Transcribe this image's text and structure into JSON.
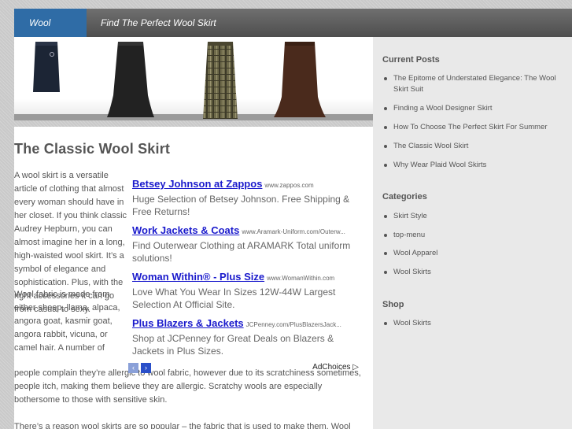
{
  "nav": {
    "home": "Wool Skirt",
    "find": "Find The Perfect Wool Skirt"
  },
  "main": {
    "title": "The Classic Wool Skirt",
    "p1": "A wool skirt is a versatile article of clothing that almost every woman should have in her closet. If you think classic Audrey Hepburn, you can almost imagine her in a long, high-waisted wool skirt.  It’s a symbol of elegance and sophistication. Plus, with the right accessories it can go from casual to sexy.",
    "p2": "Wool fabric is made from either sheep, llama, alpaca, angora goat, kasmir goat, angora rabbit, vicuna, or camel hair.  A number of",
    "p2_rest": "people complain they’re allergic to wool fabric, however due to its scratchiness sometimes, people itch, making them believe they are allergic. Scratchy wools are especially bothersome to those with sensitive skin.",
    "p3": "There’s a reason wool skirts are so popular – the fabric that is used to make them. Wool"
  },
  "ads": [
    {
      "title": "Betsey Johnson at Zappos",
      "url": "www.zappos.com",
      "desc": "Huge Selection of Betsey Johnson. Free Shipping & Free Returns!"
    },
    {
      "title": "Work Jackets & Coats",
      "url": "www.Aramark-Uniform.com/Outerw...",
      "desc": "Find Outerwear Clothing at ARAMARK Total uniform solutions!"
    },
    {
      "title": "Woman Within® - Plus Size",
      "url": "www.WomanWithin.com",
      "desc": "Love What You Wear In Sizes 12W-44W Largest Selection At Official Site."
    },
    {
      "title": "Plus Blazers & Jackets",
      "url": "JCPenney.com/PlusBlazersJack...",
      "desc": "Shop at JCPenney for Great Deals on Blazers & Jackets in Plus Sizes."
    }
  ],
  "ad_footer": {
    "prev": "‹",
    "next": "›",
    "adchoices": "AdChoices ▷"
  },
  "sidebar": {
    "current_posts_title": "Current Posts",
    "current_posts": [
      "The Epitome of Understated Elegance: The Wool Skirt Suit",
      "Finding a Wool Designer Skirt",
      "How To Choose The Perfect Skirt For Summer",
      "The Classic Wool Skirt",
      "Why Wear Plaid Wool Skirts"
    ],
    "categories_title": "Categories",
    "categories": [
      "Skirt Style",
      "top-menu",
      "Wool Apparel",
      "Wool Skirts"
    ],
    "shop_title": "Shop",
    "shop": [
      "Wool Skirts"
    ]
  },
  "colors": {
    "nav_active": "#2f6ca6",
    "nav_bg": "#5e5e5e",
    "ad_link": "#1a1acc",
    "sidebar_bg": "#e9e9e9"
  }
}
